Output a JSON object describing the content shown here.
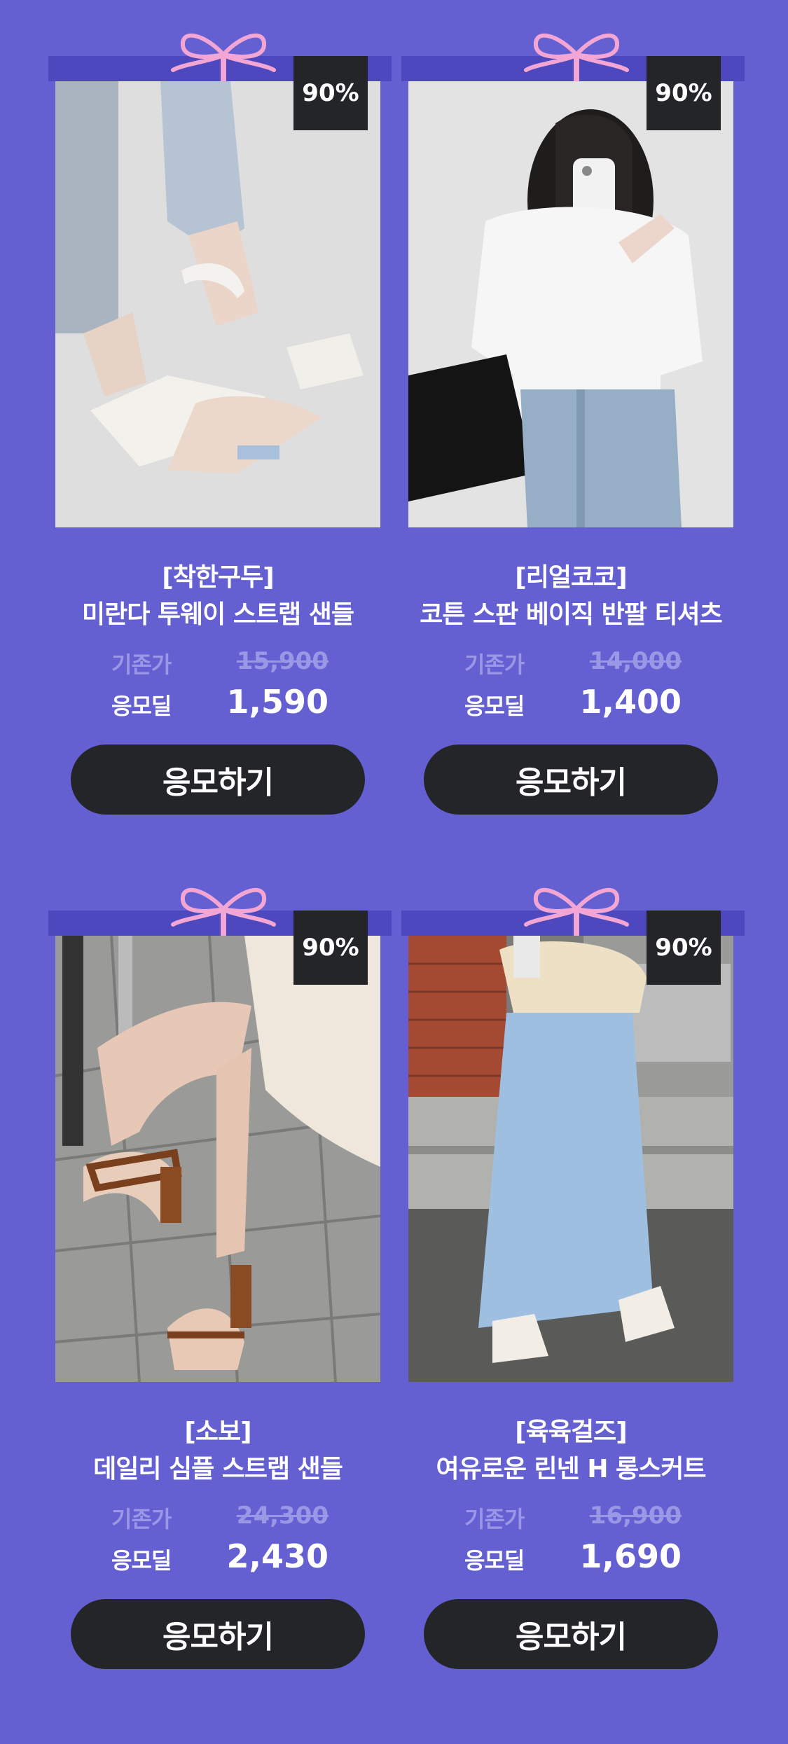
{
  "theme": {
    "background": "#6460d2",
    "ribbon": "#4d48bd",
    "bow": "#f3a6d3",
    "badge": "#242529",
    "button": "#242529",
    "muted_text": "#9a97e6"
  },
  "products": [
    {
      "discount": "90%",
      "brand": "[착한구두]",
      "name": "미란다 투웨이 스트랩 샌들",
      "original_label": "기존가",
      "original_price": "15,900",
      "deal_label": "응모딜",
      "deal_price": "1,590",
      "button": "응모하기",
      "image": "white-strap-sandals-photo"
    },
    {
      "discount": "90%",
      "brand": "[리얼코코]",
      "name": "코튼 스판 베이직 반팔 티셔츠",
      "original_label": "기존가",
      "original_price": "14,000",
      "deal_label": "응모딜",
      "deal_price": "1,400",
      "button": "응모하기",
      "image": "white-tshirt-mirror-selfie-photo"
    },
    {
      "discount": "90%",
      "brand": "[소보]",
      "name": "데일리 심플 스트랩 샌들",
      "original_label": "기존가",
      "original_price": "24,300",
      "deal_label": "응모딜",
      "deal_price": "2,430",
      "button": "응모하기",
      "image": "brown-heel-strap-sandals-photo"
    },
    {
      "discount": "90%",
      "brand": "[육육걸즈]",
      "name": "여유로운 린넨 H 롱스커트",
      "original_label": "기존가",
      "original_price": "16,900",
      "deal_label": "응모딜",
      "deal_price": "1,690",
      "button": "응모하기",
      "image": "blue-linen-long-skirt-photo"
    }
  ]
}
